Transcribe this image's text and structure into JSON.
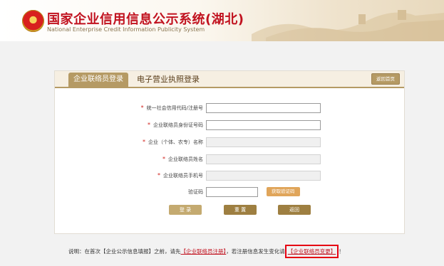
{
  "header": {
    "title": "国家企业信用信息公示系统(湖北)",
    "subtitle": "National Enterprise Credit Information Publicity System"
  },
  "tabs": {
    "active": "企业联络员登录",
    "inactive": "电子营业执照登录"
  },
  "home_button": "返回首页",
  "form": {
    "fields": [
      {
        "label": "统一社会信用代码/注册号",
        "required": true,
        "value": "",
        "enabled": true
      },
      {
        "label": "企业联络员身份证号码",
        "required": true,
        "value": "",
        "enabled": true
      },
      {
        "label": "企业（个体、农专）名称",
        "required": true,
        "value": "",
        "enabled": false
      },
      {
        "label": "企业联络员姓名",
        "required": true,
        "value": "",
        "enabled": false
      },
      {
        "label": "企业联络员手机号",
        "required": true,
        "value": "",
        "enabled": false
      }
    ],
    "captcha_label": "验证码",
    "captcha_value": "",
    "captcha_button": "获取验证码"
  },
  "buttons": {
    "login": "登 录",
    "reset": "重 置",
    "back": "返回"
  },
  "note": {
    "prefix": "说明：在首次【企业公示信息填报】之前，请先",
    "link1": "【企业联络员注册】",
    "middle": "，若注册信息发生变化请",
    "link2": "【企业联络员变更】",
    "suffix": "！"
  },
  "colors": {
    "brand_red": "#c1121f",
    "gold": "#b59a64",
    "highlight_box": "#e60012"
  }
}
